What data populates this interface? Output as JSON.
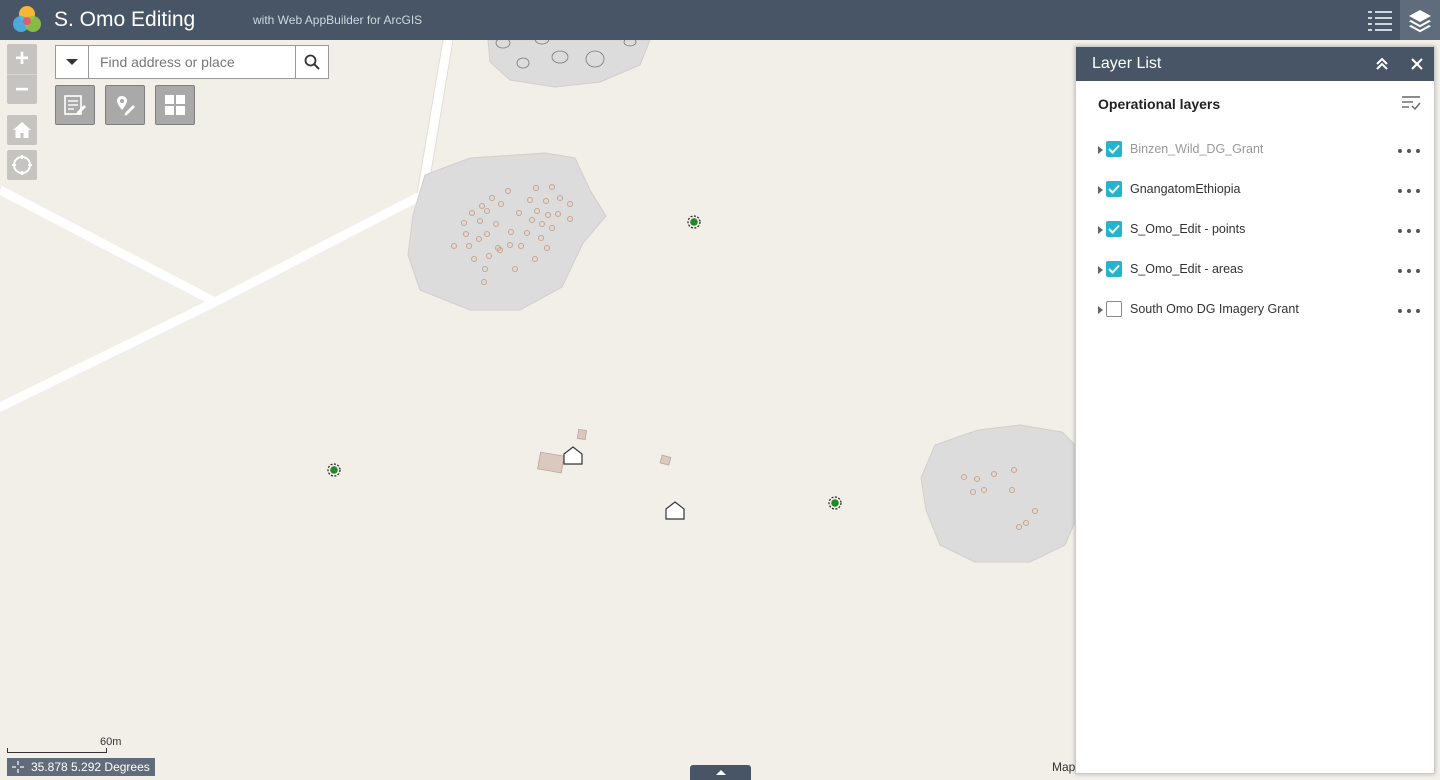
{
  "header": {
    "title": "S. Omo Editing",
    "subtitle": "with Web AppBuilder for ArcGIS",
    "icons": [
      "app-logo",
      "list-icon",
      "layers-icon"
    ]
  },
  "map_controls": {
    "zoom_in": "+",
    "zoom_out": "−",
    "icons": [
      "home-icon",
      "locate-icon"
    ]
  },
  "search": {
    "placeholder": "Find address or place",
    "value": "",
    "icons": [
      "chevron-down-icon",
      "search-icon"
    ]
  },
  "tools": {
    "icons": [
      "edit-icon",
      "draw-icon",
      "grid-icon"
    ]
  },
  "scalebar": {
    "label": "60m"
  },
  "coordinates": {
    "text": "35.878 5.292 Degrees"
  },
  "attribution": {
    "text": "Map"
  },
  "layer_list": {
    "title": "Layer List",
    "heading": "Operational layers",
    "layers": [
      {
        "name": "Binzen_Wild_DG_Grant",
        "checked": true,
        "dimmed": true
      },
      {
        "name": "GnangatomEthiopia",
        "checked": true,
        "dimmed": false
      },
      {
        "name": "S_Omo_Edit - points",
        "checked": true,
        "dimmed": false
      },
      {
        "name": "S_Omo_Edit - areas",
        "checked": true,
        "dimmed": false
      },
      {
        "name": "South Omo DG Imagery Grant",
        "checked": false,
        "dimmed": false
      }
    ]
  },
  "colors": {
    "header_bg": "#485566",
    "accent_check": "#24b5cc",
    "map_bg": "#f2efe9",
    "settlement_fill": "#dcdcdc",
    "point_marker": "#1f8a2a"
  }
}
